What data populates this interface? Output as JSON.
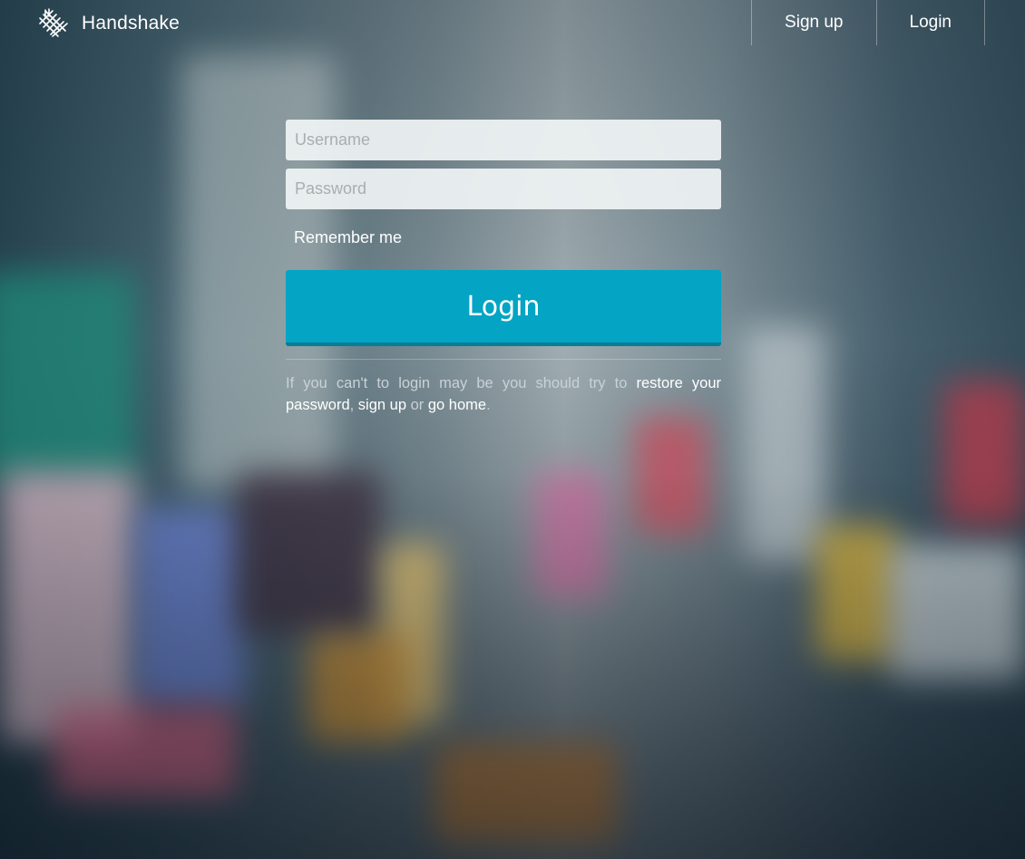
{
  "header": {
    "brand_name": "Handshake",
    "nav": [
      {
        "label": "Sign up"
      },
      {
        "label": "Login"
      }
    ]
  },
  "form": {
    "username_placeholder": "Username",
    "username_value": "",
    "password_placeholder": "Password",
    "password_value": "",
    "remember_label": "Remember me",
    "login_button": "Login"
  },
  "help": {
    "prefix": "If you can't to login may be you should try to ",
    "restore_link": "restore your password",
    "sep1": ", ",
    "signup_link": "sign up",
    "sep2": " or ",
    "home_link": "go home",
    "suffix": "."
  },
  "colors": {
    "accent": "#03a4c4",
    "accent_dark": "#087d95",
    "text": "#ffffff",
    "muted_text": "#c9d2d6"
  },
  "icons": {
    "brand": "handshake-logo-icon"
  }
}
